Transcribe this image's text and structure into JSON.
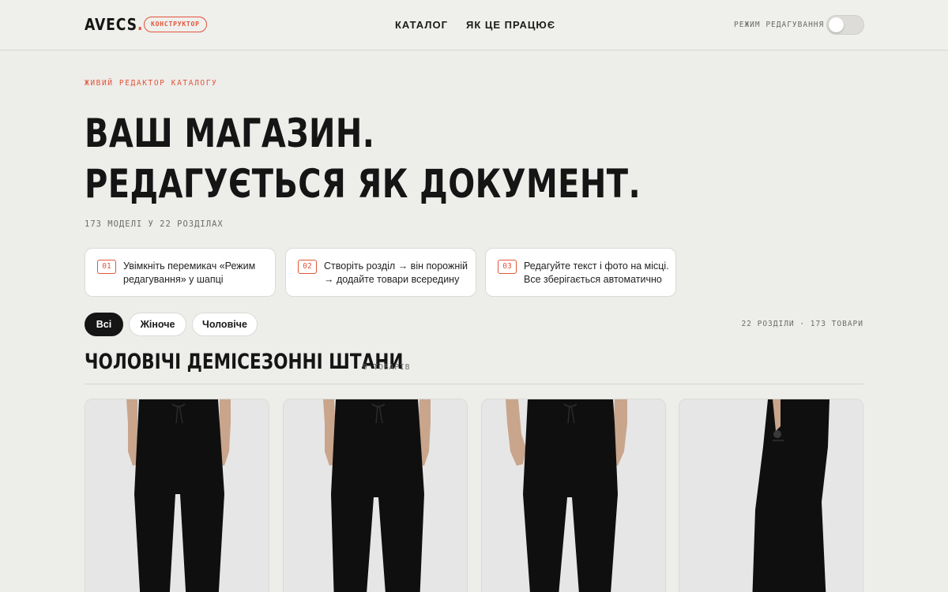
{
  "header": {
    "logo_text": "AVECS",
    "logo_dot": ".",
    "logo_badge": "КОНСТРУКТОР",
    "nav": [
      "КАТАЛОГ",
      "ЯК ЦЕ ПРАЦЮЄ"
    ],
    "edit_mode_label": "РЕЖИМ РЕДАГУВАННЯ",
    "edit_mode_on": false
  },
  "hero": {
    "eyebrow": "ЖИВИЙ РЕДАКТОР КАТАЛОГУ",
    "headline_line1": "ВАШ МАГАЗИН.",
    "headline_line2": "РЕДАГУЄТЬСЯ ЯК ДОКУМЕНТ.",
    "models_count": "173 МОДЕЛІ У 22 РОЗДІЛАХ"
  },
  "steps": [
    {
      "num": "01",
      "line1": "Увімкніть перемикач «Режим",
      "line2": "редагування» у шапці"
    },
    {
      "num": "02",
      "line1": "Створіть розділ → він порожній",
      "line2": "→ додайте товари всередину"
    },
    {
      "num": "03",
      "line1": "Редагуйте текст і фото на місці.",
      "line2": "Все зберігається автоматично"
    }
  ],
  "filters": {
    "chips": [
      "Всі",
      "Жіноче",
      "Чоловіче"
    ],
    "active": "Всі",
    "stats": "22 РОЗДІЛИ · 173 ТОВАРИ"
  },
  "section": {
    "title": "ЧОЛОВІЧІ ДЕМІСЕЗОННІ ШТАНИ",
    "count": "9 ТОВАРІВ"
  },
  "products": [
    {
      "view": "front"
    },
    {
      "view": "front"
    },
    {
      "view": "front"
    },
    {
      "view": "side"
    }
  ],
  "colors": {
    "accent": "#e2553a",
    "background": "#ededea",
    "text": "#151515"
  }
}
